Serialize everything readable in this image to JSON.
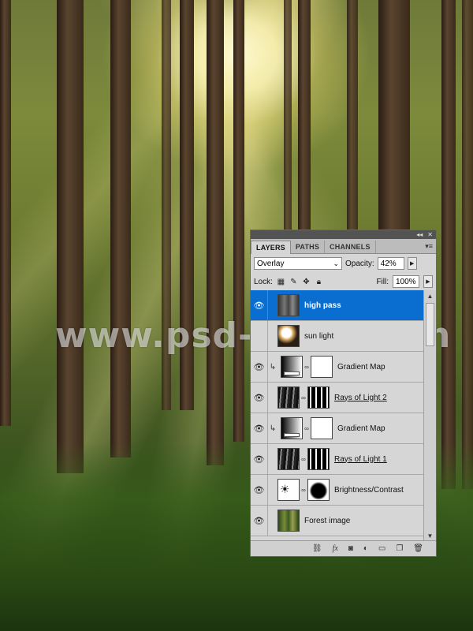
{
  "watermark": "www.psd-dude.com",
  "panel": {
    "tabs": [
      {
        "label": "LAYERS",
        "active": true
      },
      {
        "label": "PATHS",
        "active": false
      },
      {
        "label": "CHANNELS",
        "active": false
      }
    ],
    "blend_mode": "Overlay",
    "opacity_label": "Opacity:",
    "opacity_value": "42%",
    "lock_label": "Lock:",
    "fill_label": "Fill:",
    "fill_value": "100%",
    "layers": [
      {
        "name": "high pass",
        "selected": true,
        "visible": true,
        "thumb": "high-pass",
        "mask": null,
        "clipped": false,
        "underline": false
      },
      {
        "name": "sun light",
        "selected": false,
        "visible": false,
        "thumb": "sun",
        "mask": null,
        "clipped": false,
        "underline": false
      },
      {
        "name": "Gradient Map",
        "selected": false,
        "visible": true,
        "thumb": "gradient-map",
        "mask": "white",
        "clipped": true,
        "underline": false
      },
      {
        "name": "Rays of Light 2",
        "selected": false,
        "visible": true,
        "thumb": "rays",
        "mask": "rays-mask",
        "clipped": false,
        "underline": true
      },
      {
        "name": "Gradient Map",
        "selected": false,
        "visible": true,
        "thumb": "gradient-map",
        "mask": "white",
        "clipped": true,
        "underline": false
      },
      {
        "name": "Rays of Light 1",
        "selected": false,
        "visible": true,
        "thumb": "rays",
        "mask": "rays-mask",
        "clipped": false,
        "underline": true
      },
      {
        "name": "Brightness/Contrast",
        "selected": false,
        "visible": true,
        "thumb": "brightness",
        "mask": "blot-mask",
        "clipped": false,
        "underline": false
      },
      {
        "name": "Forest image",
        "selected": false,
        "visible": true,
        "thumb": "forest",
        "mask": null,
        "clipped": false,
        "underline": false
      }
    ],
    "footer_icons": [
      "link-layers-icon",
      "fx-icon",
      "add-mask-icon",
      "adjustment-layer-icon",
      "group-folder-icon",
      "new-layer-icon",
      "trash-icon"
    ]
  }
}
